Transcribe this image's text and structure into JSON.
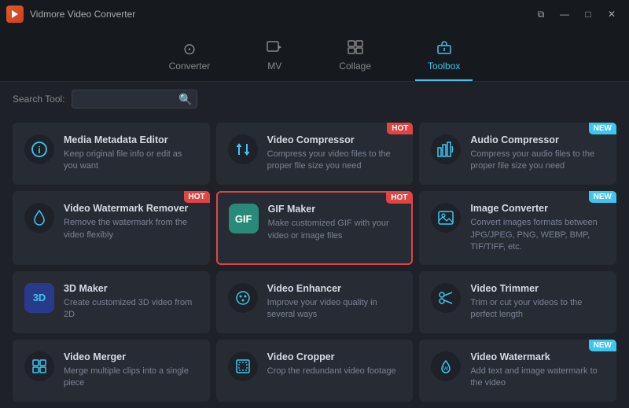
{
  "app": {
    "title": "Vidmore Video Converter",
    "logo": "V"
  },
  "titlebar": {
    "minimize": "—",
    "maximize": "□",
    "close": "✕",
    "windowed": "⧉"
  },
  "nav": {
    "items": [
      {
        "id": "converter",
        "label": "Converter",
        "icon": "⊙",
        "active": false
      },
      {
        "id": "mv",
        "label": "MV",
        "icon": "🖼",
        "active": false
      },
      {
        "id": "collage",
        "label": "Collage",
        "icon": "⊞",
        "active": false
      },
      {
        "id": "toolbox",
        "label": "Toolbox",
        "icon": "🧰",
        "active": true
      }
    ]
  },
  "search": {
    "label": "Search Tool:",
    "placeholder": "",
    "icon": "🔍"
  },
  "tools": [
    {
      "id": "media-metadata",
      "name": "Media Metadata Editor",
      "desc": "Keep original file info or edit as you want",
      "icon": "ℹ",
      "badge": null,
      "selected": false
    },
    {
      "id": "video-compressor",
      "name": "Video Compressor",
      "desc": "Compress your video files to the proper file size you need",
      "icon": "⇅",
      "badge": "Hot",
      "badge_type": "hot",
      "selected": false
    },
    {
      "id": "audio-compressor",
      "name": "Audio Compressor",
      "desc": "Compress your audio files to the proper file size you need",
      "icon": "📊",
      "badge": "New",
      "badge_type": "new",
      "selected": false
    },
    {
      "id": "video-watermark-remover",
      "name": "Video Watermark Remover",
      "desc": "Remove the watermark from the video flexibly",
      "icon": "💧",
      "badge": "Hot",
      "badge_type": "hot",
      "selected": false
    },
    {
      "id": "gif-maker",
      "name": "GIF Maker",
      "desc": "Make customized GIF with your video or image files",
      "icon": "GIF",
      "badge": "Hot",
      "badge_type": "hot",
      "selected": true
    },
    {
      "id": "image-converter",
      "name": "Image Converter",
      "desc": "Convert images formats between JPG/JPEG, PNG, WEBP, BMP, TIF/TIFF, etc.",
      "icon": "🖼",
      "badge": "New",
      "badge_type": "new",
      "selected": false
    },
    {
      "id": "3d-maker",
      "name": "3D Maker",
      "desc": "Create customized 3D video from 2D",
      "icon": "3D",
      "badge": null,
      "selected": false
    },
    {
      "id": "video-enhancer",
      "name": "Video Enhancer",
      "desc": "Improve your video quality in several ways",
      "icon": "🎨",
      "badge": null,
      "selected": false
    },
    {
      "id": "video-trimmer",
      "name": "Video Trimmer",
      "desc": "Trim or cut your videos to the perfect length",
      "icon": "✂",
      "badge": null,
      "selected": false
    },
    {
      "id": "video-merger",
      "name": "Video Merger",
      "desc": "Merge multiple clips into a single piece",
      "icon": "⊞",
      "badge": null,
      "selected": false
    },
    {
      "id": "video-cropper",
      "name": "Video Cropper",
      "desc": "Crop the redundant video footage",
      "icon": "⊡",
      "badge": null,
      "selected": false
    },
    {
      "id": "video-watermark",
      "name": "Video Watermark",
      "desc": "Add text and image watermark to the video",
      "icon": "💦",
      "badge": "New",
      "badge_type": "new",
      "selected": false
    }
  ]
}
